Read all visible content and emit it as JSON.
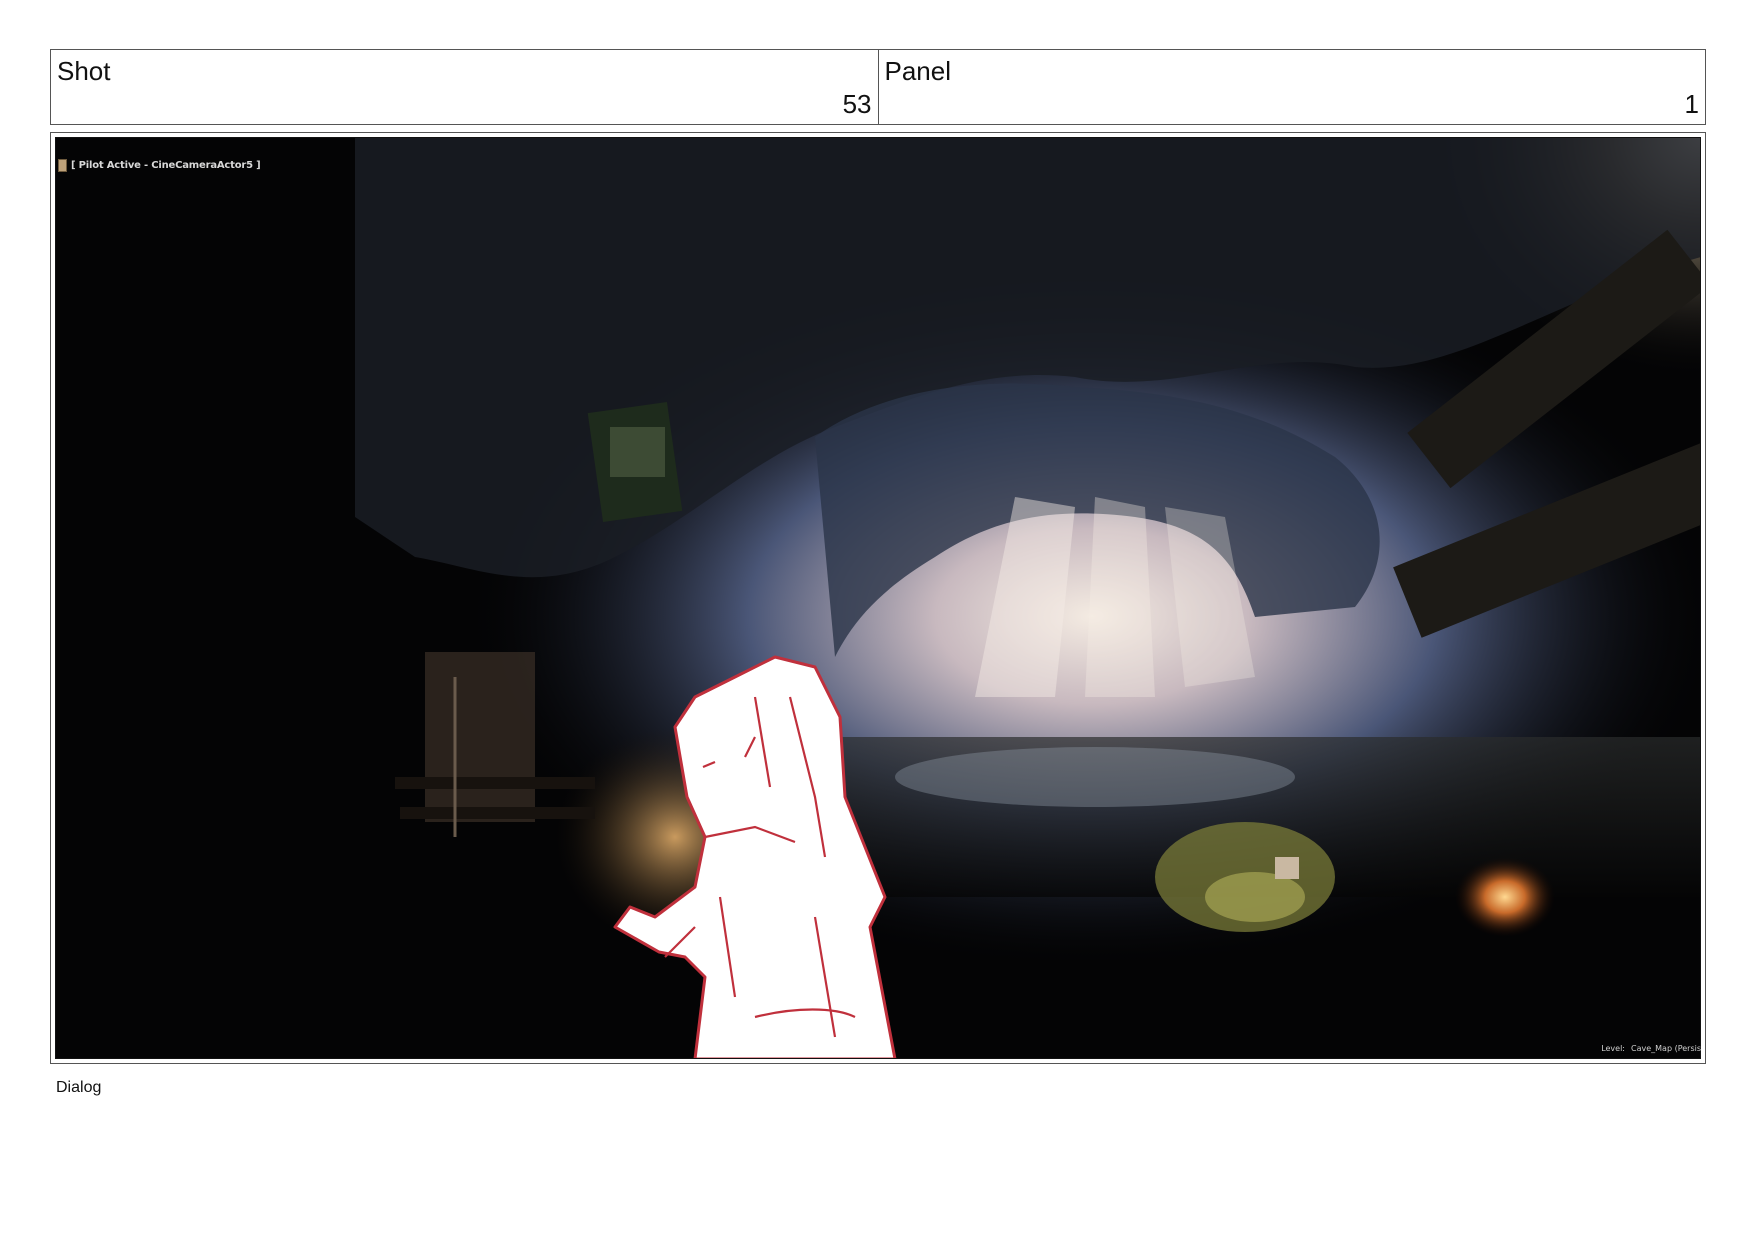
{
  "header": {
    "shot_label": "Shot",
    "shot_number": "53",
    "panel_label": "Panel",
    "panel_number": "1"
  },
  "viewport": {
    "pilot_text": "[ Pilot Active - CineCameraActor5 ]",
    "level_label": "Level:",
    "level_value": "Cave_Map (Persis"
  },
  "footer": {
    "dialog_label": "Dialog"
  },
  "colors": {
    "sketch_line": "#c0303c",
    "cave_light": "#f2e6da",
    "cave_blue": "#5a6f96",
    "frame_border": "#555555"
  },
  "icons": {
    "camera": "camera-icon"
  }
}
